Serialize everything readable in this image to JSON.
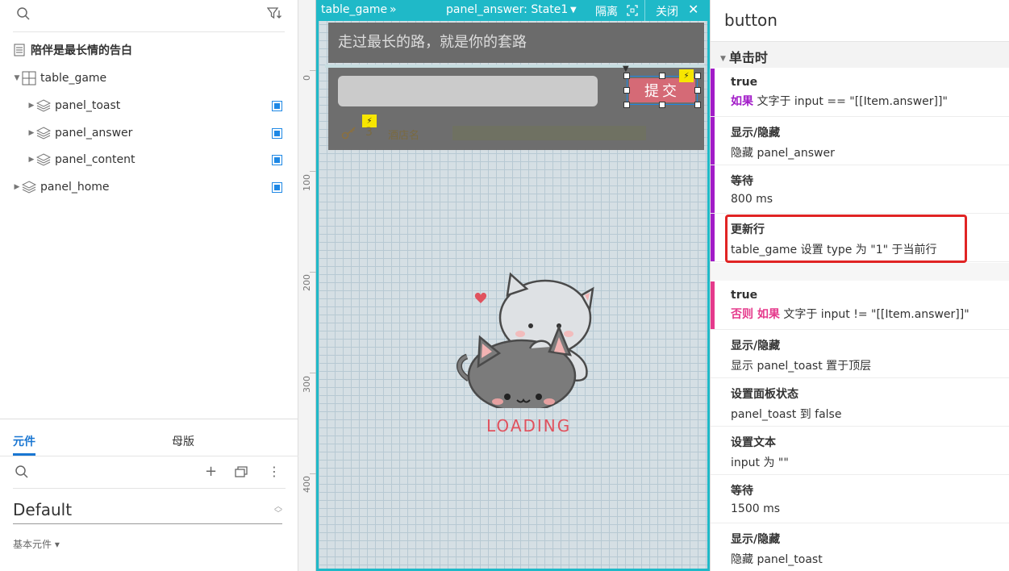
{
  "outline": {
    "page_title": "陪伴是最长情的告白",
    "items": [
      {
        "label": "table_game"
      },
      {
        "label": "panel_toast"
      },
      {
        "label": "panel_answer"
      },
      {
        "label": "panel_content"
      },
      {
        "label": "panel_home"
      }
    ]
  },
  "library": {
    "tabs": [
      "元件",
      "母版"
    ],
    "selected_library": "Default",
    "category": "基本元件"
  },
  "canvas": {
    "ruler_marks": [
      "0",
      "100",
      "200",
      "300",
      "400"
    ],
    "table_label": "table_game",
    "table_chevron": "»",
    "panel_state": "panel_answer: State1",
    "isolate_label": "隔离",
    "close_label": "关闭",
    "question": "走过最长的路，就是你的套路",
    "submit_label": "提交",
    "key_count": "3",
    "store_name": "酒店名",
    "loading": "LOADING"
  },
  "inspector": {
    "title": "button",
    "event": "单击时",
    "case1": {
      "cond_title": "true",
      "cond_kw": "如果",
      "cond_text": "文字于 input == \"[[Item.answer]]\"",
      "actions": [
        {
          "h": "显示/隐藏",
          "d": "隐藏 panel_answer"
        },
        {
          "h": "等待",
          "d": "800 ms"
        },
        {
          "h": "更新行",
          "d": "table_game 设置 type 为 \"1\" 于当前行"
        }
      ]
    },
    "case2": {
      "cond_title": "true",
      "cond_kw": "否则 如果",
      "cond_text": "文字于 input != \"[[Item.answer]]\"",
      "actions": [
        {
          "h": "显示/隐藏",
          "d": "显示 panel_toast  置于顶层"
        },
        {
          "h": "设置面板状态",
          "d": "panel_toast 到 false"
        },
        {
          "h": "设置文本",
          "d": "input 为 \"\""
        },
        {
          "h": "等待",
          "d": "1500 ms"
        },
        {
          "h": "显示/隐藏",
          "d": "隐藏 panel_toast"
        }
      ]
    },
    "colors": {
      "case1_stripe": "#a21cc8",
      "case2_stripe": "#e53a8c",
      "highlight": "#e02424",
      "accent": "#1fb9c8"
    }
  }
}
